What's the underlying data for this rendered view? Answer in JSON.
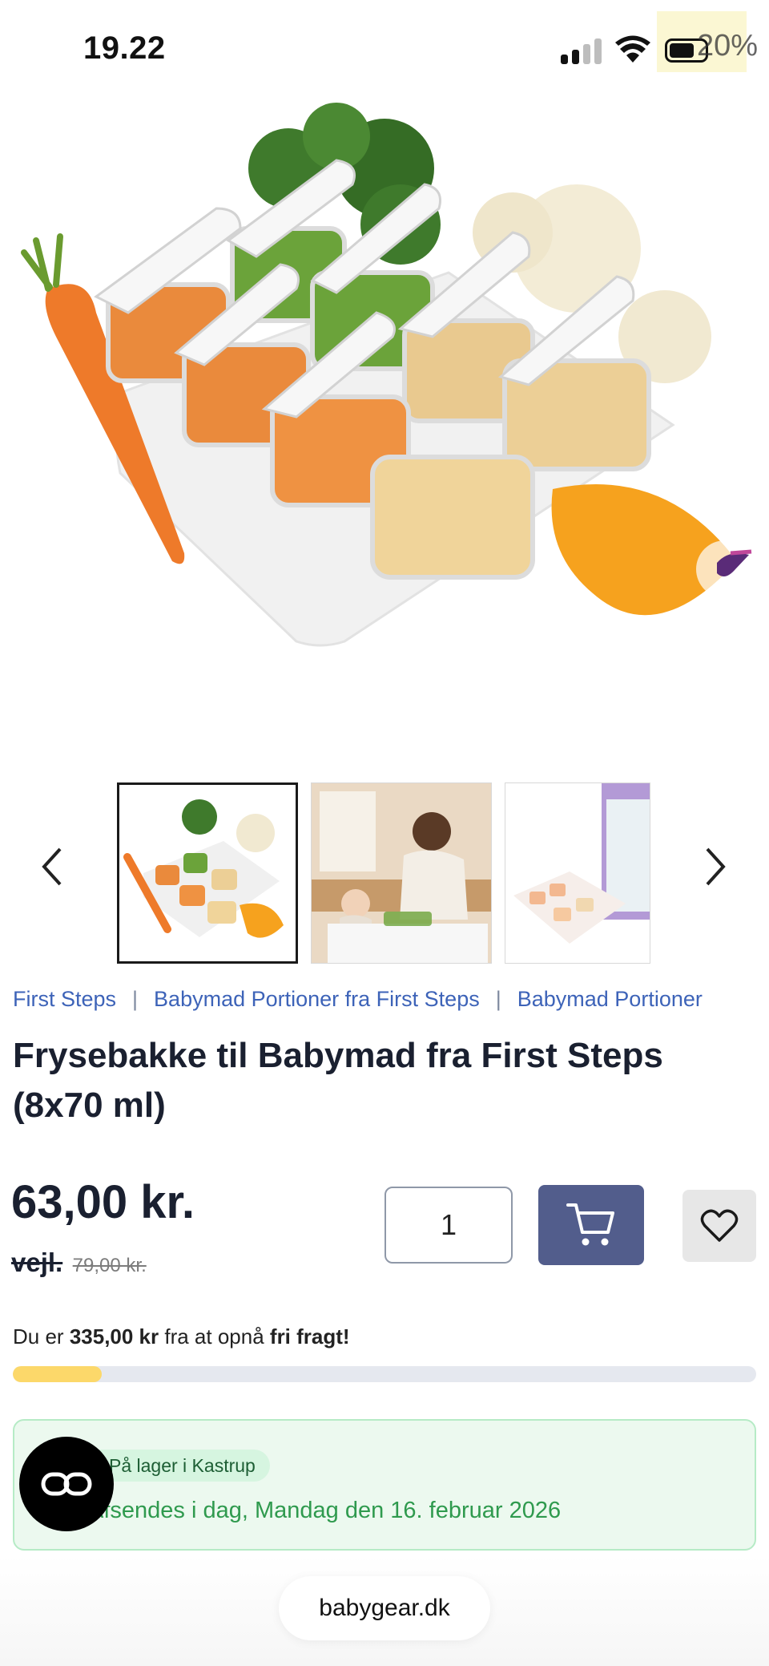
{
  "status_bar": {
    "time": "19.22",
    "battery_percent": "20%",
    "battery_level": 0.55,
    "signal_bars": 2
  },
  "gallery": {
    "thumbnails": [
      {
        "icon": "product-tray-image",
        "selected": true
      },
      {
        "icon": "kitchen-scene-image",
        "selected": false
      },
      {
        "icon": "packaging-image",
        "selected": false
      }
    ]
  },
  "breadcrumb": {
    "items": [
      "First Steps",
      "Babymad Portioner fra First Steps",
      "Babymad Portioner"
    ],
    "separator": "|"
  },
  "product": {
    "title": "Frysebakke til Babymad fra First Steps (8x70 ml)",
    "price": "63,00 kr.",
    "rrp_label": "vejl.",
    "rrp_value": "79,00 kr.",
    "quantity": "1"
  },
  "shipping": {
    "prefix": "Du er ",
    "amount": "335,00 kr",
    "middle": " fra at opnå ",
    "goal": "fri fragt!",
    "progress_fraction": 0.12
  },
  "delivery": {
    "stock_label": "På lager i Kastrup",
    "ships_text": "Afsendes i dag, Mandag den 16. februar 2026"
  },
  "browser": {
    "url": "babygear.dk"
  },
  "colors": {
    "link": "#3d63b8",
    "cart_button": "#525d8c",
    "progress_fill": "#fcd86a",
    "delivery_green": "#2f9a4e"
  }
}
